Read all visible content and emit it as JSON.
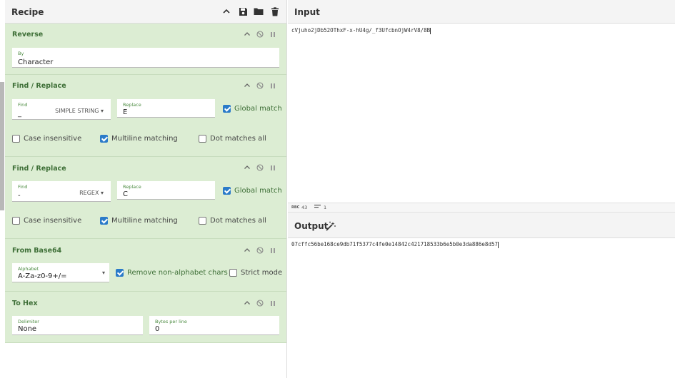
{
  "recipe": {
    "title": "Recipe",
    "header_icons": [
      "chevron-up-icon",
      "save-icon",
      "folder-icon",
      "trash-icon"
    ],
    "operations": [
      {
        "title": "Reverse",
        "fields": [
          {
            "label": "By",
            "value": "Character"
          }
        ]
      },
      {
        "title": "Find / Replace",
        "find_label": "Find",
        "find_value": "_",
        "find_type": "SIMPLE STRING",
        "replace_label": "Replace",
        "replace_value": "E",
        "global_match": "Global match",
        "case_insensitive": "Case insensitive",
        "multiline": "Multiline matching",
        "dot_matches": "Dot matches all"
      },
      {
        "title": "Find / Replace",
        "find_label": "Find",
        "find_value": "-",
        "find_type": "REGEX",
        "replace_label": "Replace",
        "replace_value": "C",
        "global_match": "Global match",
        "case_insensitive": "Case insensitive",
        "multiline": "Multiline matching",
        "dot_matches": "Dot matches all"
      },
      {
        "title": "From Base64",
        "alphabet_label": "Alphabet",
        "alphabet_value": "A-Za-z0-9+/=",
        "remove_nonalpha": "Remove non-alphabet chars",
        "strict_mode": "Strict mode"
      },
      {
        "title": "To Hex",
        "delimiter_label": "Delimiter",
        "delimiter_value": "None",
        "bytes_label": "Bytes per line",
        "bytes_value": "0"
      }
    ]
  },
  "input": {
    "title": "Input",
    "text": "cVjuho2jDb52OThxF-x-hU4g/_f3UfcbnOjW4rV8/8B",
    "status_chars_label": "RBC",
    "status_chars": "43",
    "status_lines": "1"
  },
  "output": {
    "title": "Output",
    "text": "07cffc56be168ce9db71f5377c4fe0e14842c421718533b6e5b0e3da886e8d57"
  },
  "colors": {
    "op_background": "#dcedd3",
    "op_title": "#3e6f37",
    "checkbox_on": "#2b7bc9"
  }
}
